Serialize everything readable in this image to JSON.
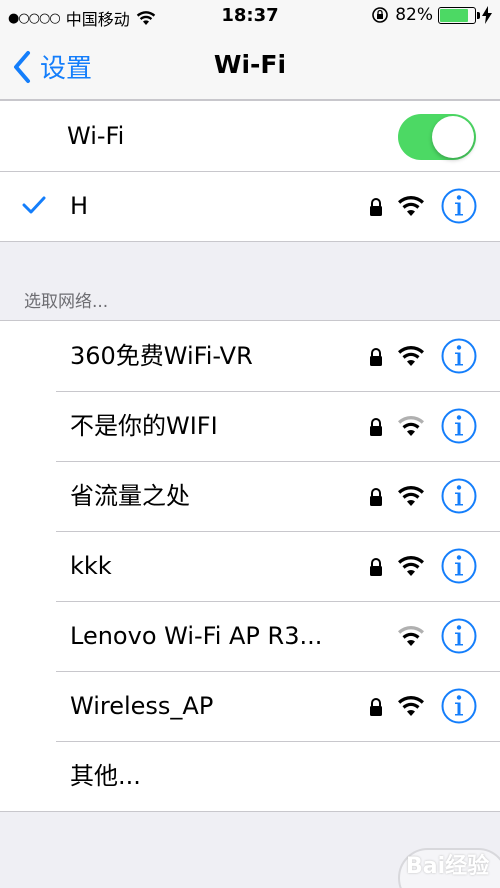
{
  "status_bar": {
    "signal_dots": "●○○○○",
    "carrier": "中国移动",
    "time": "18:37",
    "battery_percent": "82%",
    "battery_level": 0.82,
    "battery_color": "#4cd964"
  },
  "nav": {
    "back_label": "设置",
    "title": "Wi-Fi"
  },
  "wifi_toggle": {
    "label": "Wi-Fi",
    "on": true,
    "color": "#4cd964"
  },
  "connected": {
    "name": "H",
    "secured": true,
    "signal": "full"
  },
  "section_header": "选取网络...",
  "networks": [
    {
      "name": "360免费WiFi-VR",
      "secured": true,
      "signal": "full"
    },
    {
      "name": "不是你的WIFI",
      "secured": true,
      "signal": "partial"
    },
    {
      "name": "省流量之处",
      "secured": true,
      "signal": "full"
    },
    {
      "name": "kkk",
      "secured": true,
      "signal": "full"
    },
    {
      "name": "Lenovo Wi-Fi AP R3...",
      "secured": false,
      "signal": "partial"
    },
    {
      "name": "Wireless_AP",
      "secured": true,
      "signal": "full"
    }
  ],
  "other_label": "其他...",
  "accent_color": "#147efb",
  "watermark_text": "Bai经验"
}
